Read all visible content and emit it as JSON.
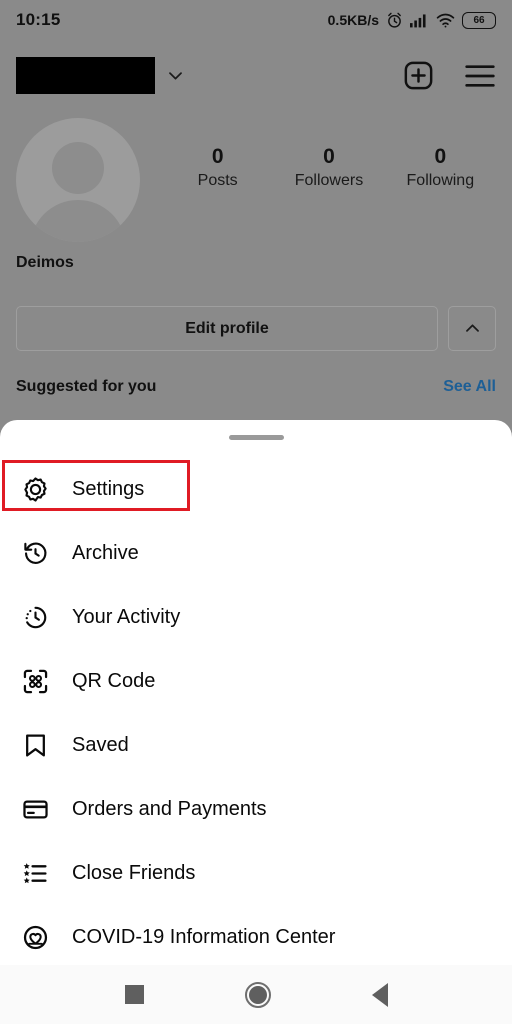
{
  "status_bar": {
    "time": "10:15",
    "network_speed": "0.5KB/s",
    "alarm_icon": "alarm-icon",
    "signal_icon": "cellular-signal-icon",
    "wifi_icon": "wifi-icon",
    "battery_level": "66"
  },
  "app_bar": {
    "username": "",
    "username_redacted": true,
    "dropdown_icon": "chevron-down-icon",
    "new_post_icon": "plus-square-icon",
    "menu_icon": "hamburger-menu-icon"
  },
  "profile": {
    "avatar_icon": "default-avatar-icon",
    "display_name": "Deimos",
    "stats": [
      {
        "count": "0",
        "label": "Posts"
      },
      {
        "count": "0",
        "label": "Followers"
      },
      {
        "count": "0",
        "label": "Following"
      }
    ],
    "edit_profile_label": "Edit profile",
    "expand_icon": "chevron-up-icon",
    "suggested_title": "Suggested for you",
    "see_all_label": "See All"
  },
  "sheet": {
    "handle": "drag-handle",
    "items": [
      {
        "label": "Settings",
        "icon": "gear-icon",
        "highlighted": true
      },
      {
        "label": "Archive",
        "icon": "archive-clock-icon",
        "highlighted": false
      },
      {
        "label": "Your Activity",
        "icon": "activity-clock-icon",
        "highlighted": false
      },
      {
        "label": "QR Code",
        "icon": "qr-code-icon",
        "highlighted": false
      },
      {
        "label": "Saved",
        "icon": "bookmark-icon",
        "highlighted": false
      },
      {
        "label": "Orders and Payments",
        "icon": "credit-card-icon",
        "highlighted": false
      },
      {
        "label": "Close Friends",
        "icon": "star-list-icon",
        "highlighted": false
      },
      {
        "label": "COVID-19 Information Center",
        "icon": "heart-circle-icon",
        "highlighted": false
      }
    ]
  },
  "nav_bar": {
    "recents_icon": "square-recents-icon",
    "home_icon": "circle-home-icon",
    "back_icon": "triangle-back-icon"
  },
  "colors": {
    "highlight": "#e01b24",
    "link": "#1d5f96",
    "backdrop": "#8a8a8a",
    "sheet": "#ffffff"
  }
}
